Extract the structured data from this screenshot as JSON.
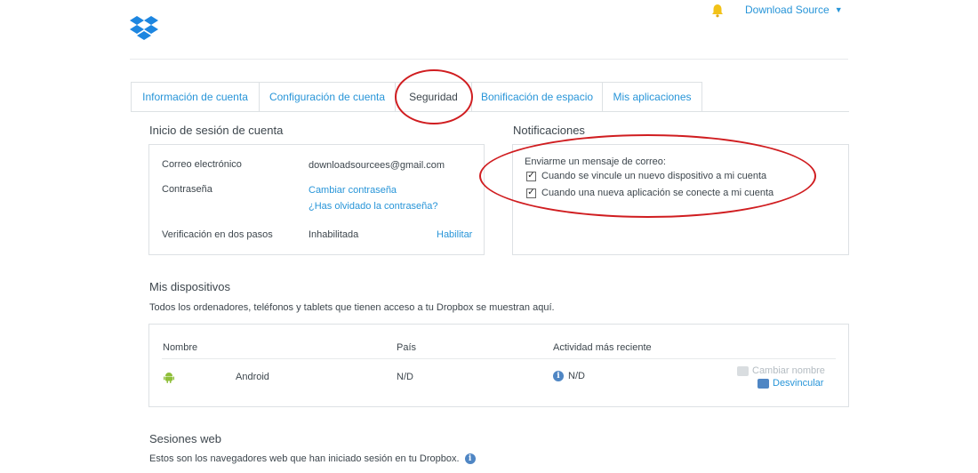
{
  "header": {
    "logo_icon": "dropbox-logo-icon",
    "notification_icon": "bell-icon",
    "user_menu_label": "Download Source",
    "user_menu_caret": "▼"
  },
  "tabs": [
    {
      "label": "Información de cuenta",
      "active": false
    },
    {
      "label": "Configuración de cuenta",
      "active": false
    },
    {
      "label": "Seguridad",
      "active": true
    },
    {
      "label": "Bonificación de espacio",
      "active": false
    },
    {
      "label": "Mis aplicaciones",
      "active": false
    }
  ],
  "account_signin": {
    "title": "Inicio de sesión de cuenta",
    "email_label": "Correo electrónico",
    "email_value": "downloadsourcees@gmail.com",
    "password_label": "Contraseña",
    "change_password_link": "Cambiar contraseña",
    "forgot_password_link": "¿Has olvidado la contraseña?",
    "two_step_label": "Verificación en dos pasos",
    "two_step_status": "Inhabilitada",
    "two_step_enable_link": "Habilitar"
  },
  "notifications": {
    "title": "Notificaciones",
    "heading": "Enviarme un mensaje de correo:",
    "options": [
      {
        "label": "Cuando se vincule un nuevo dispositivo a mi cuenta",
        "checked": true
      },
      {
        "label": "Cuando una nueva aplicación se conecte a mi cuenta",
        "checked": true
      }
    ]
  },
  "devices": {
    "title": "Mis dispositivos",
    "description": "Todos los ordenadores, teléfonos y tablets que tienen acceso a tu Dropbox se muestran aquí.",
    "columns": {
      "name": "Nombre",
      "country": "País",
      "activity": "Actividad más reciente"
    },
    "rows": [
      {
        "icon": "android-icon",
        "name": "Android",
        "country": "N/D",
        "activity": "N/D",
        "rename_label": "Cambiar nombre",
        "unlink_label": "Desvincular"
      }
    ]
  },
  "web_sessions": {
    "title": "Sesiones web",
    "description": "Estos son los navegadores web que han iniciado sesión en tu Dropbox."
  },
  "colors": {
    "link": "#2895d8",
    "annotation_red": "#d01d20",
    "text": "#3d464d",
    "border": "#dde1e4"
  }
}
